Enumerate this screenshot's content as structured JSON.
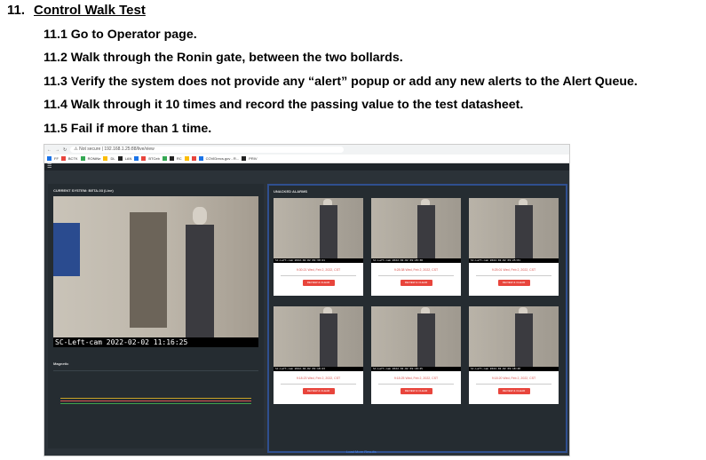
{
  "heading": {
    "number": "11.",
    "title": "Control Walk Test"
  },
  "steps": [
    "11.1 Go to Operator page.",
    "11.2 Walk through the Ronin gate, between the two bollards.",
    "11.3 Verify the system does not provide any “alert” popup or add any new alerts to the Alert Queue.",
    "11.4 Walk through it 10 times and record the passing value to the test datasheet.",
    "11.5 Fail if more than 1 time."
  ],
  "screenshot": {
    "browser": {
      "security": "Not secure",
      "address": "192.168.1.25:88/live/view"
    },
    "bookmarks": [
      "FF",
      "BCTK",
      "RONiNe",
      "DL",
      "LAN",
      "BTCeb",
      "RC",
      "COVIDrecs.gov - R...",
      "PRIV"
    ],
    "current_system_label": "CURRENT SYSTEM: BETA-03 (Live)",
    "camera_label": "SC-Left-cam 2022-02-02 11:16:25",
    "magnetic_label": "Magnetic",
    "unacked_label": "UNACKED ALARMS",
    "cards": [
      {
        "cap": "SC-Left-cam 2022-02-02 09:30:21",
        "ts": "9:30:21 Wed, Feb 2, 2022, CST",
        "button": "REVIEW & CLEAR"
      },
      {
        "cap": "SC-Left-cam 2022-02-02 09:28:38",
        "ts": "9:28:38 Wed, Feb 2, 2022, CST",
        "button": "REVIEW & CLEAR"
      },
      {
        "cap": "SC-Left-cam 2022-02-02 09:25:01",
        "ts": "9:25:01 Wed, Feb 2, 2022, CST",
        "button": "REVIEW & CLEAR"
      },
      {
        "cap": "SC-Left-cam 2022-02-02 09:18:23",
        "ts": "9:18:23 Wed, Feb 2, 2022, CST",
        "button": "REVIEW & CLEAR"
      },
      {
        "cap": "SC-Left-cam 2022-02-02 09:18:25",
        "ts": "9:18:25 Wed, Feb 2, 2022, CST",
        "button": "REVIEW & CLEAR"
      },
      {
        "cap": "SC-Left-cam 2022-02-02 09:18:20",
        "ts": "9:18:20 Wed, Feb 2, 2022, CST",
        "button": "REVIEW & CLEAR"
      }
    ],
    "footer_link": "Load More Results"
  }
}
